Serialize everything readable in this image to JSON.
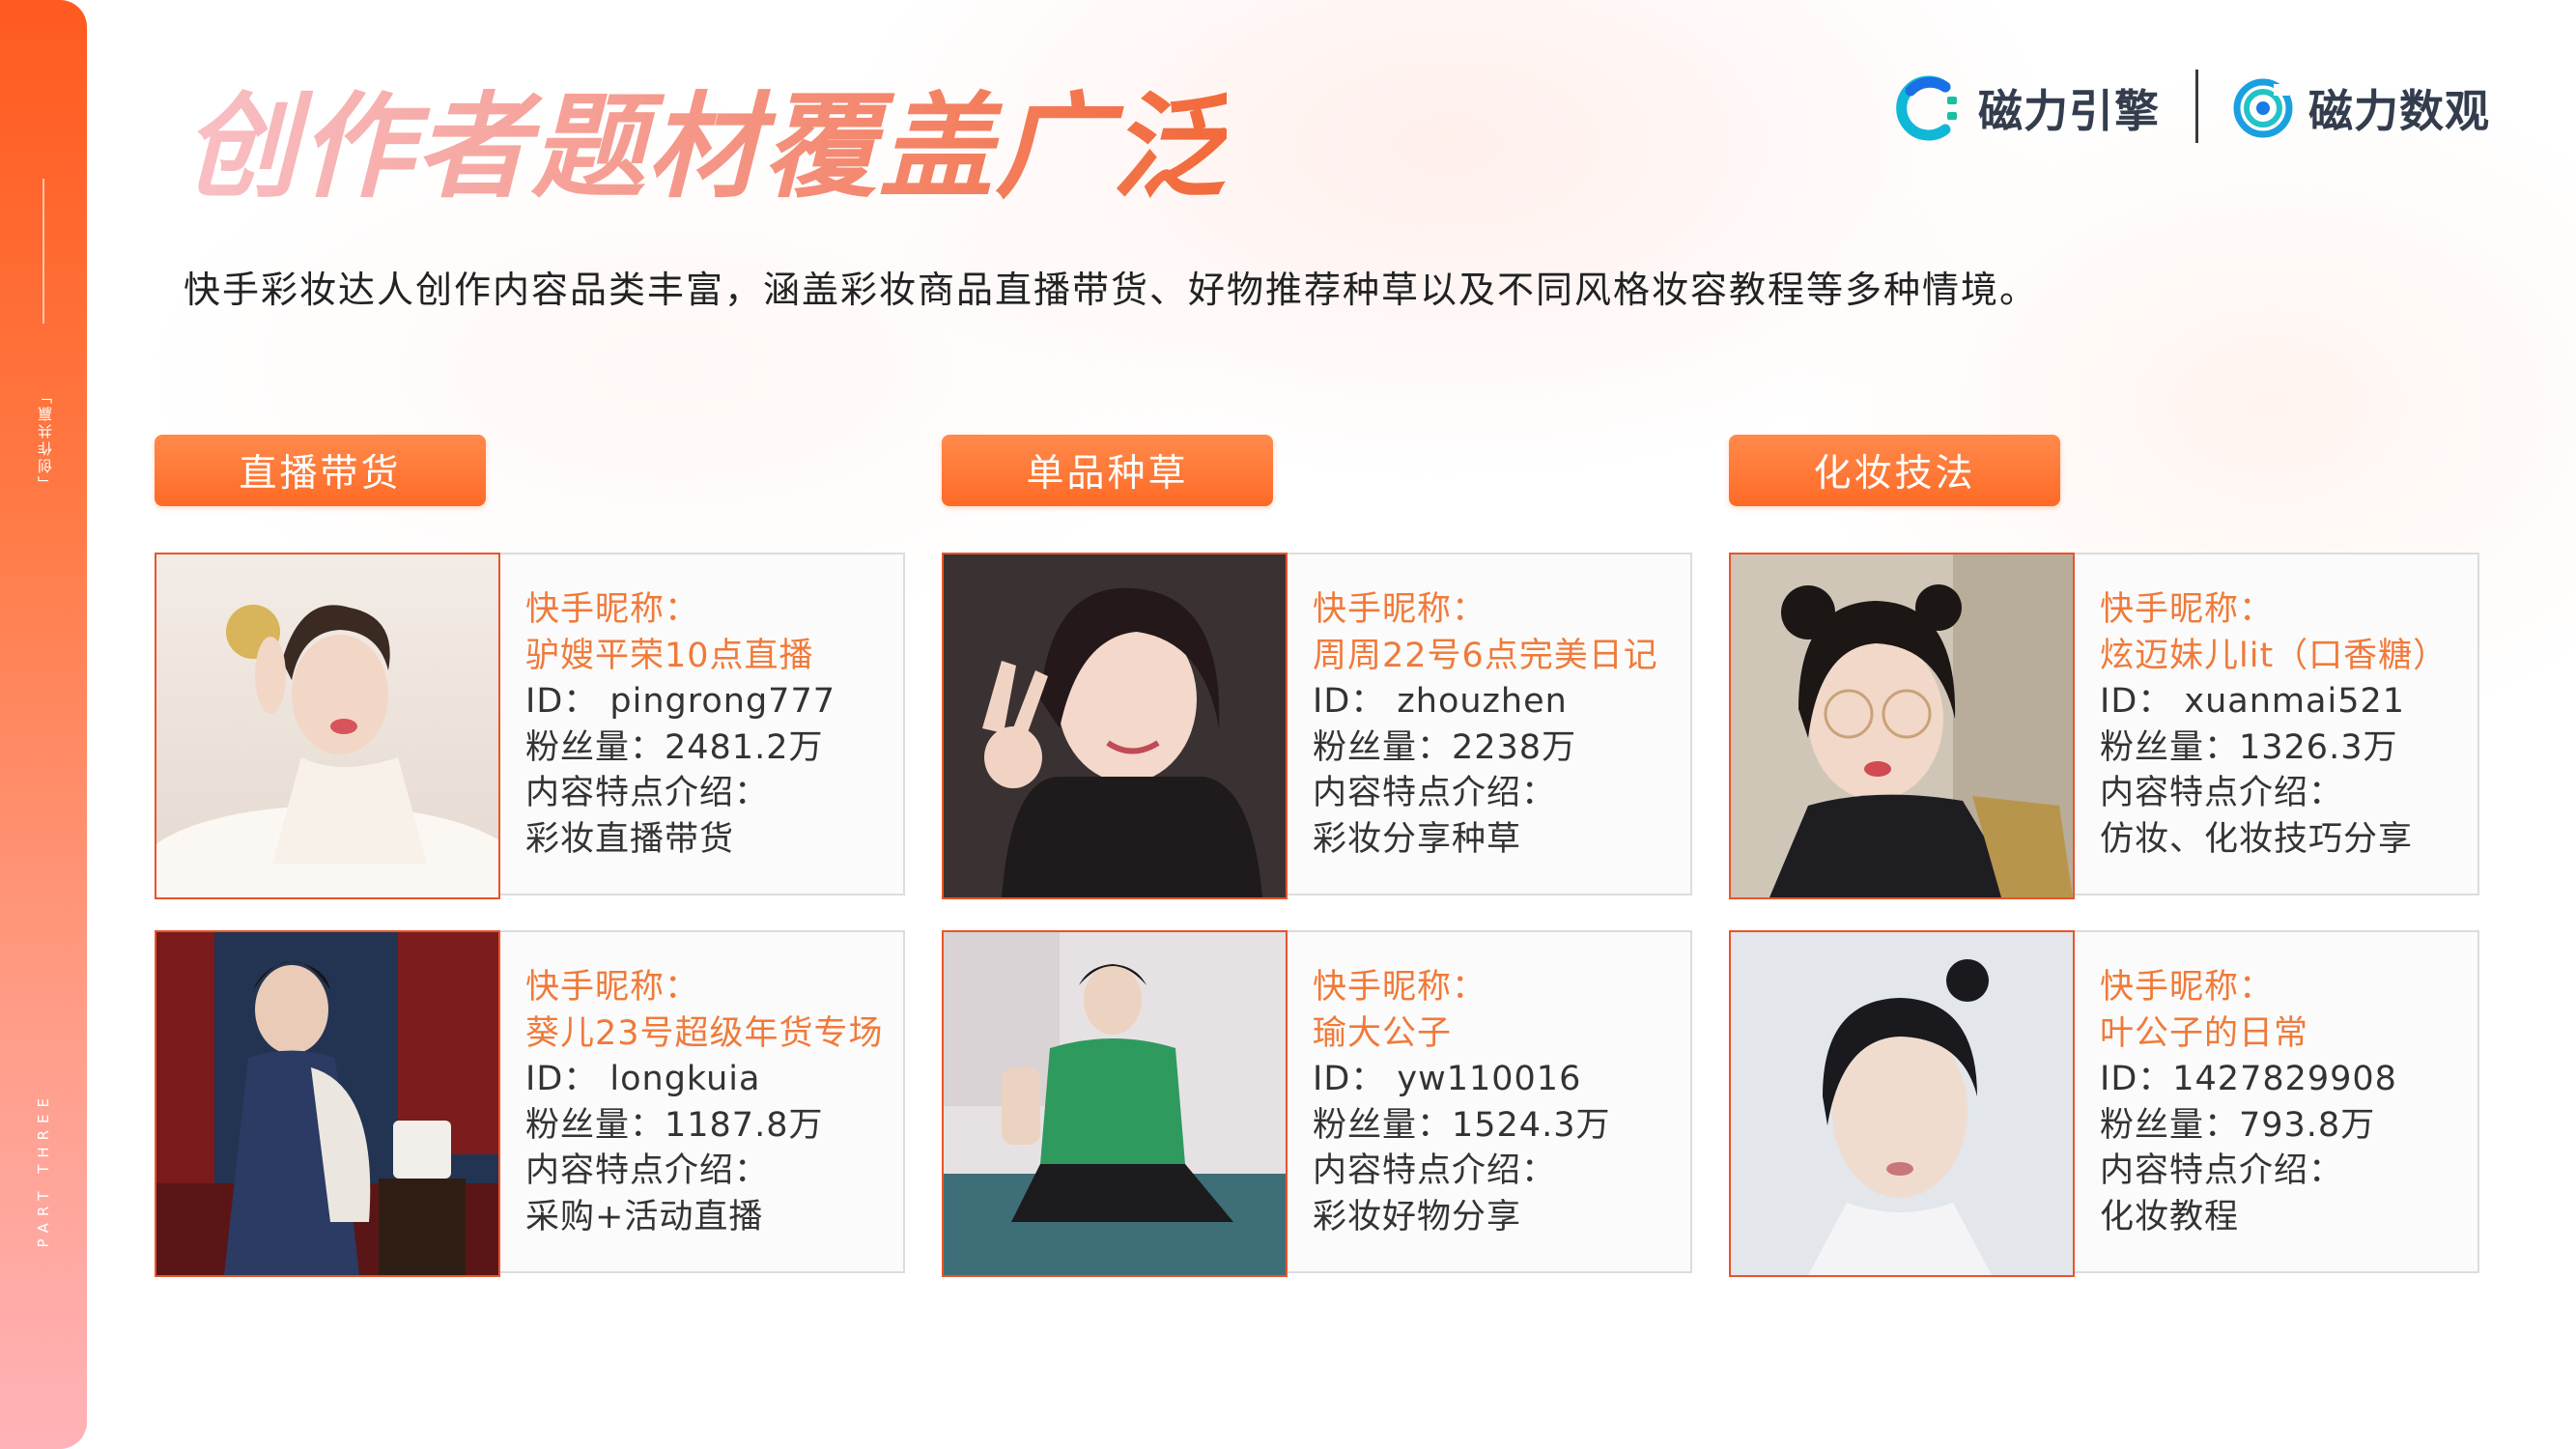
{
  "side": {
    "top_label": "「创作共赢」",
    "bottom_label": "PART THREE"
  },
  "title": "创作者题材覆盖广泛",
  "logos": [
    {
      "name": "磁力引擎",
      "icon": "magnet-engine-logo-icon"
    },
    {
      "name": "磁力数观",
      "icon": "magnet-insight-logo-icon"
    }
  ],
  "subtitle": "快手彩妆达人创作内容品类丰富，涵盖彩妆商品直播带货、好物推荐种草以及不同风格妆容教程等多种情境。",
  "columns": [
    {
      "tag": "直播带货",
      "cards": [
        {
          "nick_label": "快手昵称：",
          "nickname": "驴嫂平荣10点直播",
          "id_line": "ID： pingrong777",
          "fans_line": "粉丝量：2481.2万",
          "intro_label": "内容特点介绍：",
          "intro": "彩妆直播带货"
        },
        {
          "nick_label": "快手昵称：",
          "nickname": "葵儿23号超级年货专场",
          "id_line": "ID： longkuia",
          "fans_line": "粉丝量：1187.8万",
          "intro_label": "内容特点介绍：",
          "intro": "采购+活动直播"
        }
      ]
    },
    {
      "tag": "单品种草",
      "cards": [
        {
          "nick_label": "快手昵称：",
          "nickname": "周周22号6点完美日记",
          "id_line": "ID： zhouzhen",
          "fans_line": "粉丝量：2238万",
          "intro_label": "内容特点介绍：",
          "intro": "彩妆分享种草"
        },
        {
          "nick_label": "快手昵称：",
          "nickname": "瑜大公子",
          "id_line": "ID： yw110016",
          "fans_line": "粉丝量：1524.3万",
          "intro_label": "内容特点介绍：",
          "intro": "彩妆好物分享"
        }
      ]
    },
    {
      "tag": "化妆技法",
      "cards": [
        {
          "nick_label": "快手昵称：",
          "nickname": "炫迈妹儿lit（口香糖）",
          "id_line": "ID： xuanmai521",
          "fans_line": "粉丝量：1326.3万",
          "intro_label": "内容特点介绍：",
          "intro": "仿妆、化妆技巧分享"
        },
        {
          "nick_label": "快手昵称：",
          "nickname": "叶公子的日常",
          "id_line": "ID：1427829908",
          "fans_line": "粉丝量：793.8万",
          "intro_label": "内容特点介绍：",
          "intro": "化妆教程"
        }
      ]
    }
  ],
  "colors": {
    "accent": "#ff6a26",
    "highlight_text": "#f07a3a",
    "card_border": "#dcdcdc",
    "photo_border": "#e9542a"
  }
}
